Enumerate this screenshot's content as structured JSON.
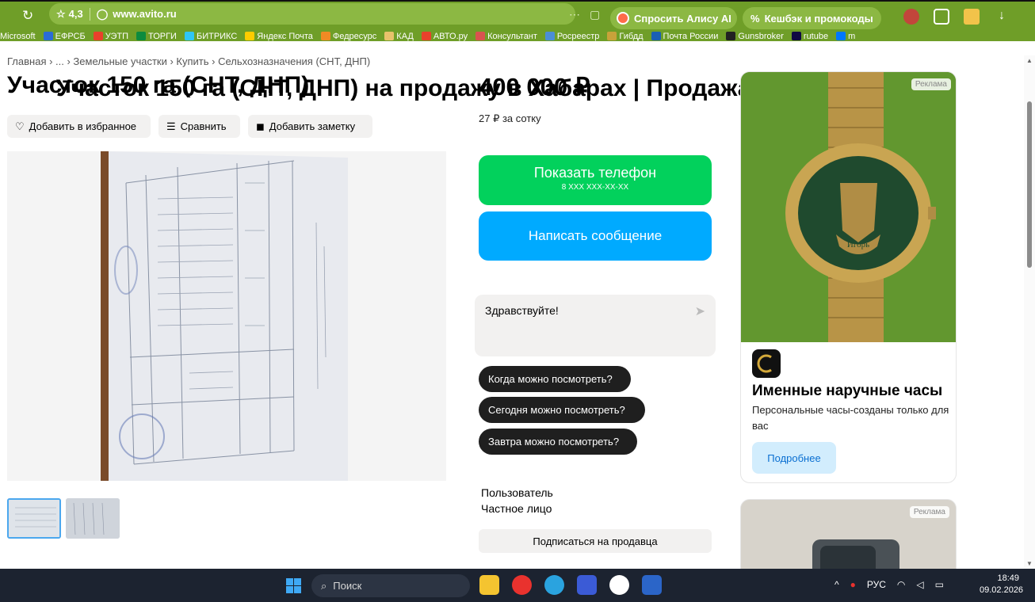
{
  "browser": {
    "rating": "4,3",
    "domain": "www.avito.ru",
    "tab_title": "Участок 150 га (СНТ, ДНП) на продажу в Хабарах | Продажа земель...",
    "alice_label": "Спросить Алису AI",
    "cashback_label": "Кешбэк и промокоды",
    "bookmarks": [
      {
        "label": "Microsoft",
        "color": "#6f9e28"
      },
      {
        "label": "ЕФРСБ",
        "color": "#2b6cd6"
      },
      {
        "label": "УЭТП",
        "color": "#e8412b"
      },
      {
        "label": "ТОРГИ",
        "color": "#0c8b3e"
      },
      {
        "label": "БИТРИКС",
        "color": "#2fc6f6"
      },
      {
        "label": "Яндекс Почта",
        "color": "#ffcc00"
      },
      {
        "label": "Федресурс",
        "color": "#f08a24"
      },
      {
        "label": "КАД",
        "color": "#e8c26b"
      },
      {
        "label": "АВТО.ру",
        "color": "#e8412b"
      },
      {
        "label": "Консультант",
        "color": "#d9534f"
      },
      {
        "label": "Росреестр",
        "color": "#4b8ed6"
      },
      {
        "label": "Гибдд",
        "color": "#c8a23a"
      },
      {
        "label": "Почта России",
        "color": "#1a5fb4"
      },
      {
        "label": "Gunsbroker",
        "color": "#222222"
      },
      {
        "label": "rutube",
        "color": "#100943"
      },
      {
        "label": "m",
        "color": "#0077ff"
      }
    ]
  },
  "page": {
    "breadcrumb": "Главная › ... › Земельные участки › Купить › Сельхозназначения (СНТ, ДНП)",
    "title": "Участок 150 га (СНТ, ДНП)",
    "actions": {
      "favorite": "Добавить в избранное",
      "compare": "Сравнить",
      "note": "Добавить заметку"
    },
    "price": "400 000 ₽",
    "price_per": "27 ₽ за сотку",
    "phone_button": "Показать телефон",
    "phone_mask": "8 XXX XXX-XX-XX",
    "message_button": "Написать сообщение",
    "chat_placeholder": "Здравствуйте!",
    "quick_questions": [
      "Когда можно посмотреть?",
      "Сегодня можно посмотреть?",
      "Завтра можно посмотреть?"
    ],
    "seller": {
      "name": "Пользователь",
      "type": "Частное лицо",
      "subscribe": "Подписаться на продавца"
    }
  },
  "ad": {
    "label": "Реклама",
    "title": "Именные наручные часы",
    "description": "Персональные часы-созданы только для вас",
    "button": "Подробнее",
    "watch_engraving": "Игорь",
    "label2": "Реклама"
  },
  "taskbar": {
    "search_placeholder": "Поиск",
    "lang": "РУС",
    "time": "18:49",
    "date": "09.02.2026"
  }
}
